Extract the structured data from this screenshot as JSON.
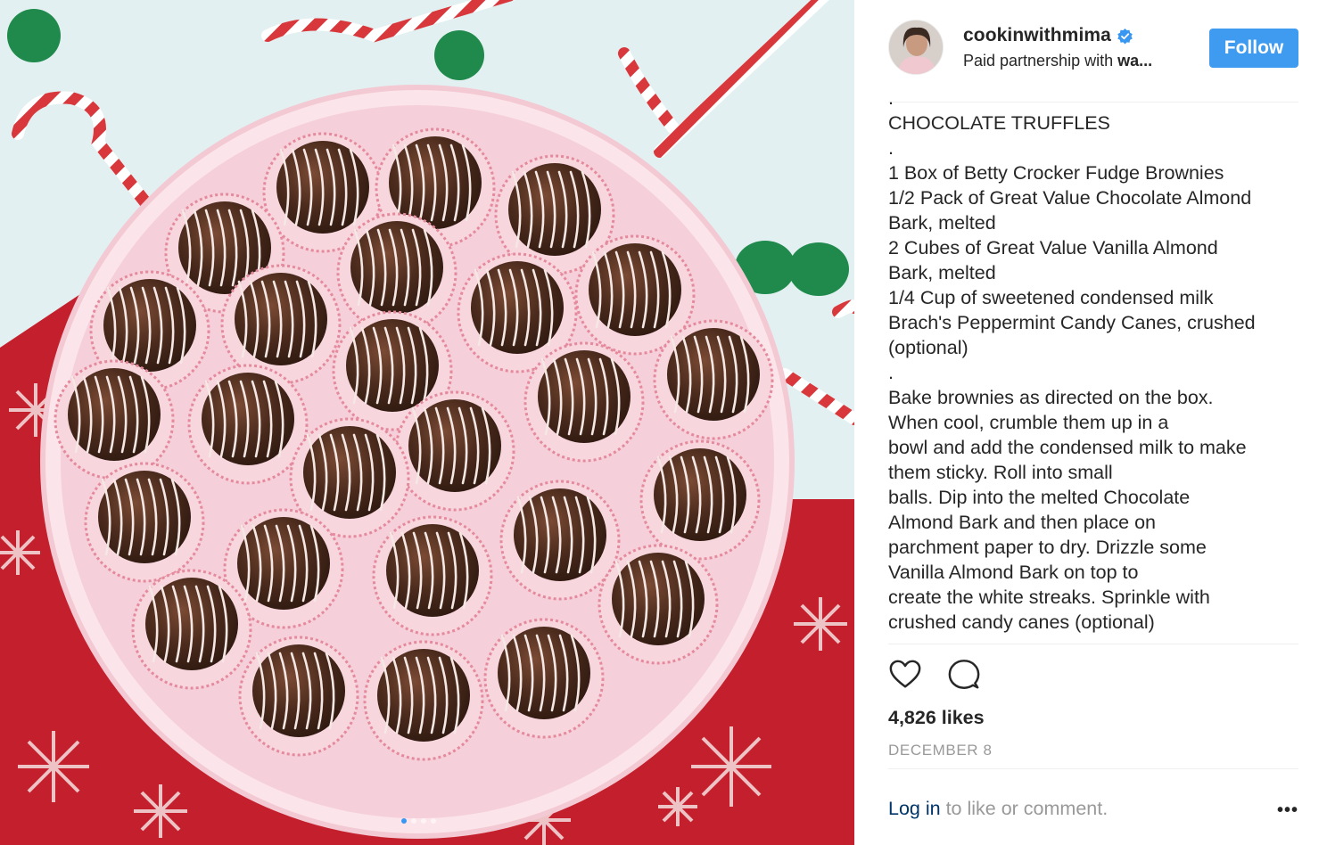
{
  "post": {
    "username": "cookinwithmima",
    "subtitle_prefix": "Paid partnership with ",
    "subtitle_partner": "wa...",
    "follow_label": "Follow",
    "verified_icon": "verified-badge-icon",
    "caption_lines": [
      ".",
      "CHOCOLATE TRUFFLES",
      ".",
      "1 Box of Betty Crocker Fudge Brownies",
      "1/2 Pack of Great Value Chocolate Almond",
      "Bark, melted",
      "2 Cubes of Great Value Vanilla Almond",
      "Bark, melted",
      "1/4 Cup of sweetened condensed milk",
      "Brach's Peppermint Candy Canes, crushed",
      "(optional)",
      ".",
      "Bake brownies as directed on the box.",
      "When cool, crumble them up in a",
      "bowl and add the condensed milk to make",
      "them sticky. Roll into small",
      "balls. Dip into the melted Chocolate",
      "Almond Bark and then place on",
      "parchment paper to dry. Drizzle some",
      "Vanilla Almond Bark on top to",
      "create the white streaks. Sprinkle with",
      "crushed candy canes (optional)"
    ],
    "likes": "4,826 likes",
    "date": "DECEMBER 8",
    "login_link": "Log in",
    "login_rest": " to like or comment.",
    "more_label": "•••",
    "carousel": {
      "count": 4,
      "active_index": 0
    },
    "icons": {
      "like": "heart-outline-icon",
      "comment": "comment-bubble-icon"
    }
  },
  "colors": {
    "follow_button": "#3f9bf0",
    "verified_badge": "#3897f0",
    "link": "#003569",
    "muted": "#999999",
    "divider": "#efefef"
  }
}
